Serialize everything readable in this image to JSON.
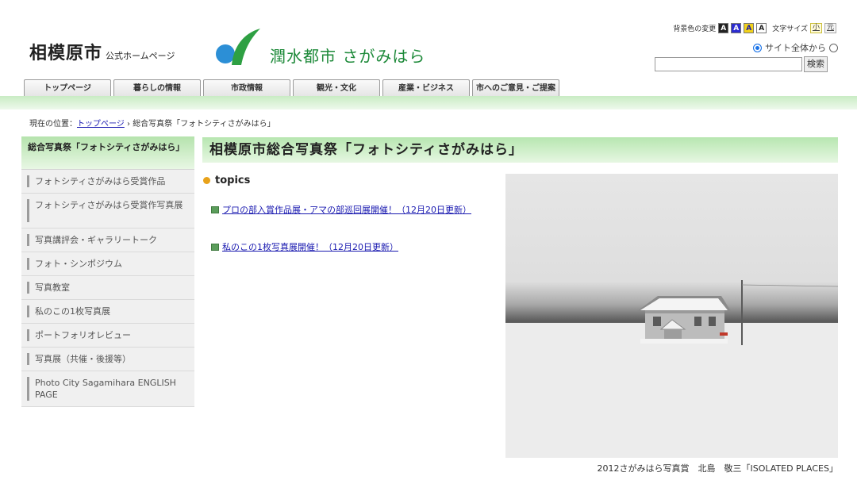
{
  "header": {
    "site_name": "相模原市",
    "site_suffix": "公式ホームページ",
    "logo_text": "潤水都市 さがみはら"
  },
  "utility": {
    "bg_color_label": "背景色の変更",
    "color_buttons": [
      "A",
      "A",
      "A",
      "A"
    ],
    "font_size_label": "文字サイズ",
    "font_size_small": "小",
    "font_size_original": "元",
    "search_scope_site": "サイト全体から",
    "search_button": "検索",
    "search_value": ""
  },
  "nav": {
    "tabs": [
      "トップページ",
      "暮らしの情報",
      "市政情報",
      "観光・文化",
      "産業・ビジネス",
      "市へのご意見・ご提案"
    ]
  },
  "breadcrumb": {
    "prefix": "現在の位置：",
    "home": "トップページ",
    "separator": "›",
    "current": "総合写真祭「フォトシティさがみはら」"
  },
  "sidebar": {
    "heading": "総合写真祭「フォトシティさがみはら」",
    "items": [
      "フォトシティさがみはら受賞作品",
      "フォトシティさがみはら受賞作写真展",
      "写真講評会・ギャラリートーク",
      "フォト・シンポジウム",
      "写真教室",
      "私のこの1枚写真展",
      "ポートフォリオレビュー",
      "写真展（共催・後援等）",
      "Photo City Sagamihara ENGLISH PAGE"
    ]
  },
  "main": {
    "title": "相模原市総合写真祭「フォトシティさがみはら」",
    "topics_label": "topics",
    "news": [
      "プロの部入賞作品展・アマの部巡回展開催！（12月20日更新）",
      "私のこの1枚写真展開催！（12月20日更新）"
    ],
    "photo_caption": "2012さがみはら写真賞　北島　敬三「ISOLATED PLACES」"
  },
  "colors": {
    "accent_green": "#b7e6b0",
    "link": "#1a1ab0",
    "logo_green": "#1e8a3a",
    "logo_blue": "#2c8fd6"
  }
}
